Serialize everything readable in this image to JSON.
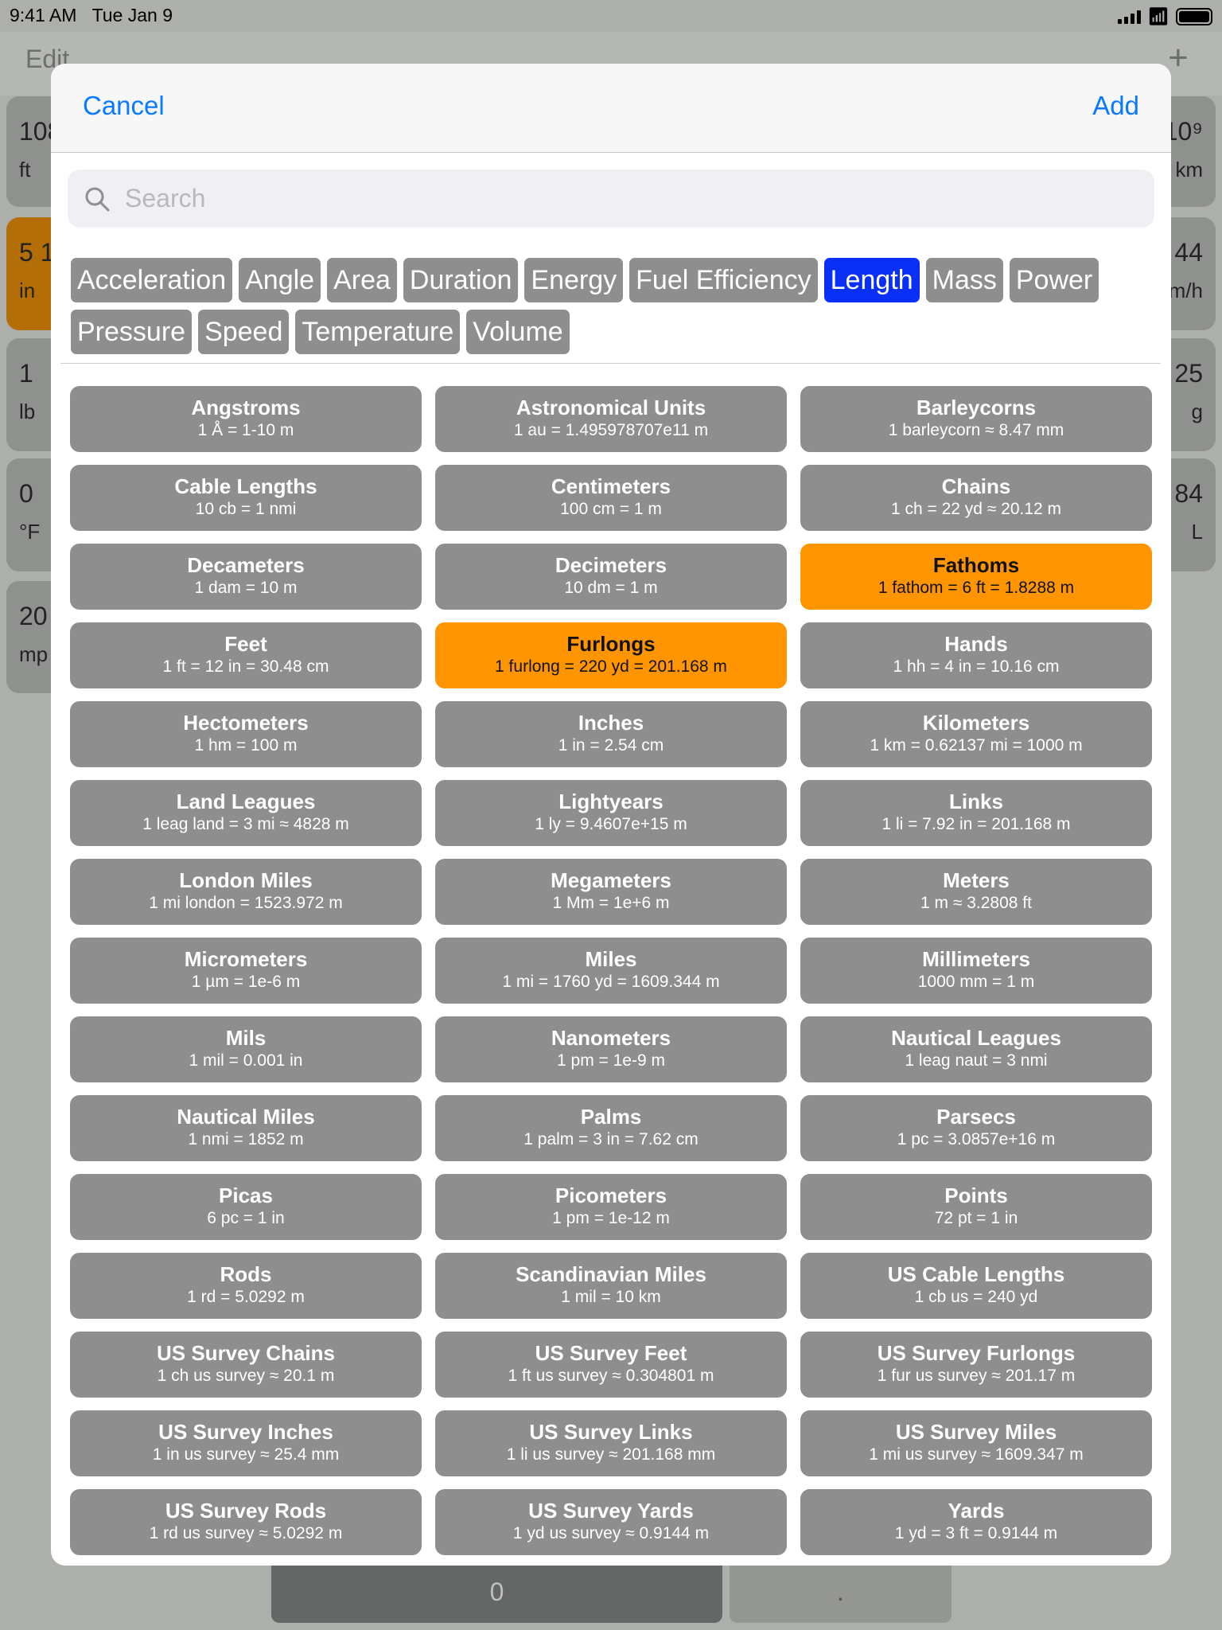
{
  "status": {
    "time": "9:41 AM",
    "date": "Tue Jan 9"
  },
  "nav": {
    "edit": "Edit",
    "plus": "+"
  },
  "background_cards": {
    "left": [
      {
        "value": "108",
        "unit": "ft"
      },
      {
        "value": "5 1",
        "unit": "in"
      },
      {
        "value": "1",
        "unit": "lb"
      },
      {
        "value": "0",
        "unit": "°F"
      },
      {
        "value": "20",
        "unit": "mp"
      }
    ],
    "right": [
      {
        "value": "10⁹",
        "unit": "km"
      },
      {
        "value": "44",
        "unit": "m/h"
      },
      {
        "value": "25",
        "unit": "g"
      },
      {
        "value": "84",
        "unit": "L"
      }
    ]
  },
  "modal": {
    "cancel": "Cancel",
    "add": "Add",
    "search_placeholder": "Search",
    "categories": [
      "Acceleration",
      "Angle",
      "Area",
      "Duration",
      "Energy",
      "Fuel Efficiency",
      "Length",
      "Mass",
      "Power",
      "Pressure",
      "Speed",
      "Temperature",
      "Volume"
    ],
    "selected_category": "Length",
    "units": [
      {
        "name": "Angstroms",
        "desc": "1 Å = 1-10 m"
      },
      {
        "name": "Astronomical Units",
        "desc": "1 au = 1.495978707e11 m"
      },
      {
        "name": "Barleycorns",
        "desc": "1 barleycorn ≈ 8.47 mm"
      },
      {
        "name": "Cable Lengths",
        "desc": "10 cb = 1 nmi"
      },
      {
        "name": "Centimeters",
        "desc": "100 cm = 1 m"
      },
      {
        "name": "Chains",
        "desc": "1 ch = 22 yd ≈ 20.12 m"
      },
      {
        "name": "Decameters",
        "desc": "1 dam = 10 m"
      },
      {
        "name": "Decimeters",
        "desc": "10 dm = 1 m"
      },
      {
        "name": "Fathoms",
        "desc": "1 fathom = 6 ft = 1.8288 m",
        "highlighted": true
      },
      {
        "name": "Feet",
        "desc": "1 ft = 12 in = 30.48 cm"
      },
      {
        "name": "Furlongs",
        "desc": "1 furlong = 220 yd = 201.168 m",
        "highlighted": true
      },
      {
        "name": "Hands",
        "desc": "1 hh = 4 in = 10.16 cm"
      },
      {
        "name": "Hectometers",
        "desc": "1 hm = 100 m"
      },
      {
        "name": "Inches",
        "desc": "1 in = 2.54 cm"
      },
      {
        "name": "Kilometers",
        "desc": "1 km = 0.62137 mi = 1000 m"
      },
      {
        "name": "Land Leagues",
        "desc": "1 leag land = 3 mi ≈ 4828 m"
      },
      {
        "name": "Lightyears",
        "desc": "1 ly = 9.4607e+15 m"
      },
      {
        "name": "Links",
        "desc": "1 li = 7.92 in = 201.168 m"
      },
      {
        "name": "London Miles",
        "desc": "1 mi london = 1523.972 m"
      },
      {
        "name": "Megameters",
        "desc": "1 Mm = 1e+6 m"
      },
      {
        "name": "Meters",
        "desc": "1 m ≈ 3.2808 ft"
      },
      {
        "name": "Micrometers",
        "desc": "1 µm = 1e-6 m"
      },
      {
        "name": "Miles",
        "desc": "1 mi = 1760 yd = 1609.344 m"
      },
      {
        "name": "Millimeters",
        "desc": "1000 mm = 1 m"
      },
      {
        "name": "Mils",
        "desc": "1 mil = 0.001 in"
      },
      {
        "name": "Nanometers",
        "desc": "1 pm = 1e-9 m"
      },
      {
        "name": "Nautical Leagues",
        "desc": "1 leag naut = 3 nmi"
      },
      {
        "name": "Nautical Miles",
        "desc": "1 nmi = 1852 m"
      },
      {
        "name": "Palms",
        "desc": "1 palm = 3 in = 7.62 cm"
      },
      {
        "name": "Parsecs",
        "desc": "1 pc = 3.0857e+16 m"
      },
      {
        "name": "Picas",
        "desc": "6 pc = 1 in"
      },
      {
        "name": "Picometers",
        "desc": "1 pm = 1e-12 m"
      },
      {
        "name": "Points",
        "desc": "72 pt = 1 in"
      },
      {
        "name": "Rods",
        "desc": "1 rd = 5.0292 m"
      },
      {
        "name": "Scandinavian Miles",
        "desc": "1 mil = 10 km"
      },
      {
        "name": "US Cable Lengths",
        "desc": "1 cb us = 240 yd"
      },
      {
        "name": "US Survey Chains",
        "desc": "1 ch us survey ≈ 20.1 m"
      },
      {
        "name": "US Survey Feet",
        "desc": "1 ft us survey ≈ 0.304801 m"
      },
      {
        "name": "US Survey Furlongs",
        "desc": "1 fur us survey ≈ 201.17 m"
      },
      {
        "name": "US Survey Inches",
        "desc": "1 in us survey ≈ 25.4 mm"
      },
      {
        "name": "US Survey Links",
        "desc": "1 li us survey ≈ 201.168 mm"
      },
      {
        "name": "US Survey Miles",
        "desc": "1 mi us survey ≈ 1609.347 m"
      },
      {
        "name": "US Survey Rods",
        "desc": "1 rd us survey ≈ 5.0292 m"
      },
      {
        "name": "US Survey Yards",
        "desc": "1 yd us survey ≈ 0.9144 m"
      },
      {
        "name": "Yards",
        "desc": "1 yd = 3 ft = 0.9144 m"
      }
    ]
  },
  "keypad": {
    "zero": "0",
    "dot": "."
  },
  "colors": {
    "accent": "#0a7aff",
    "selected_chip": "#0a2ff5",
    "highlight": "#ff9500",
    "chip": "#8e8e8e"
  }
}
